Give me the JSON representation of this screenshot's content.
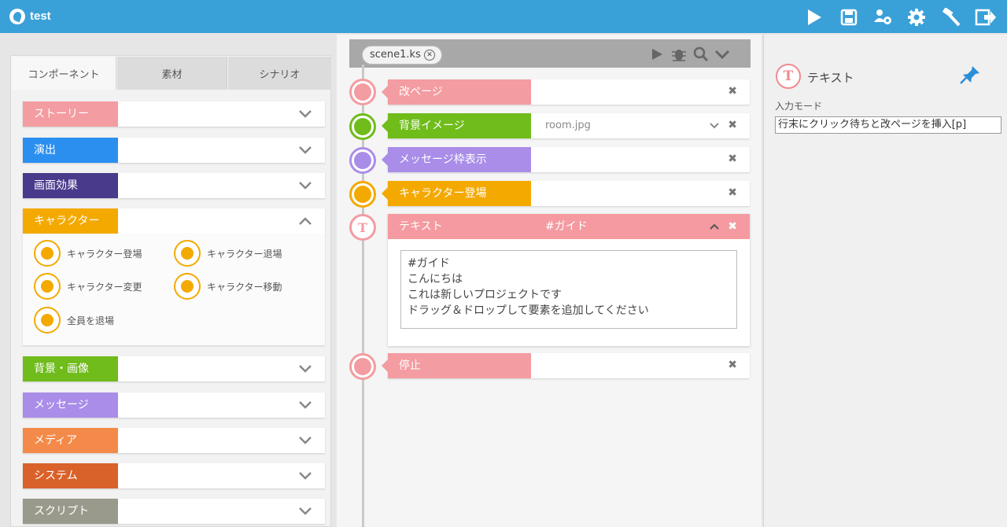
{
  "app": {
    "title": "test"
  },
  "toolbar": {
    "icons": [
      "play-icon",
      "save-icon",
      "users-gear-icon",
      "gear-icon",
      "hammer-icon",
      "exit-icon"
    ]
  },
  "left_panel": {
    "tabs": [
      {
        "label": "コンポーネント",
        "active": true
      },
      {
        "label": "素材",
        "active": false
      },
      {
        "label": "シナリオ",
        "active": false
      }
    ],
    "categories": [
      {
        "label": "ストーリー",
        "color": "#f39ca1",
        "expanded": false
      },
      {
        "label": "演出",
        "color": "#2b8ff0",
        "expanded": false
      },
      {
        "label": "画面効果",
        "color": "#4a3a8c",
        "expanded": false
      },
      {
        "label": "キャラクター",
        "color": "#f4a900",
        "expanded": true
      },
      {
        "label": "背景・画像",
        "color": "#6fbc1b",
        "expanded": false
      },
      {
        "label": "メッセージ",
        "color": "#a98de8",
        "expanded": false
      },
      {
        "label": "メディア",
        "color": "#f48a4a",
        "expanded": false
      },
      {
        "label": "システム",
        "color": "#d9622b",
        "expanded": false
      },
      {
        "label": "スクリプト",
        "color": "#9a9a8c",
        "expanded": false
      }
    ],
    "character_components": [
      "キャラクター登場",
      "キャラクター退場",
      "キャラクター変更",
      "キャラクター移動",
      "全員を退場"
    ]
  },
  "scene": {
    "tab_label": "scene1.ks",
    "icons": [
      "play-icon",
      "bug-icon",
      "search-icon",
      "chevron-down-icon"
    ],
    "rows": [
      {
        "label": "改ページ",
        "color": "#f39ca1",
        "value": ""
      },
      {
        "label": "背景イメージ",
        "color": "#6fbc1b",
        "value": "room.jpg"
      },
      {
        "label": "メッセージ枠表示",
        "color": "#a98de8",
        "value": ""
      },
      {
        "label": "キャラクター登場",
        "color": "#f4a900",
        "value": ""
      }
    ],
    "text_block": {
      "label": "テキスト",
      "tag": "#ガイド",
      "lines": [
        "#ガイド",
        "こんにちは",
        "これは新しいプロジェクトです",
        "ドラッグ＆ドロップして要素を追加してください"
      ]
    },
    "stop_row": {
      "label": "停止",
      "color": "#f39ca1"
    }
  },
  "properties": {
    "title": "テキスト",
    "mode_label": "入力モード",
    "mode_value": "行末にクリック待ちと改ページを挿入[p]"
  }
}
